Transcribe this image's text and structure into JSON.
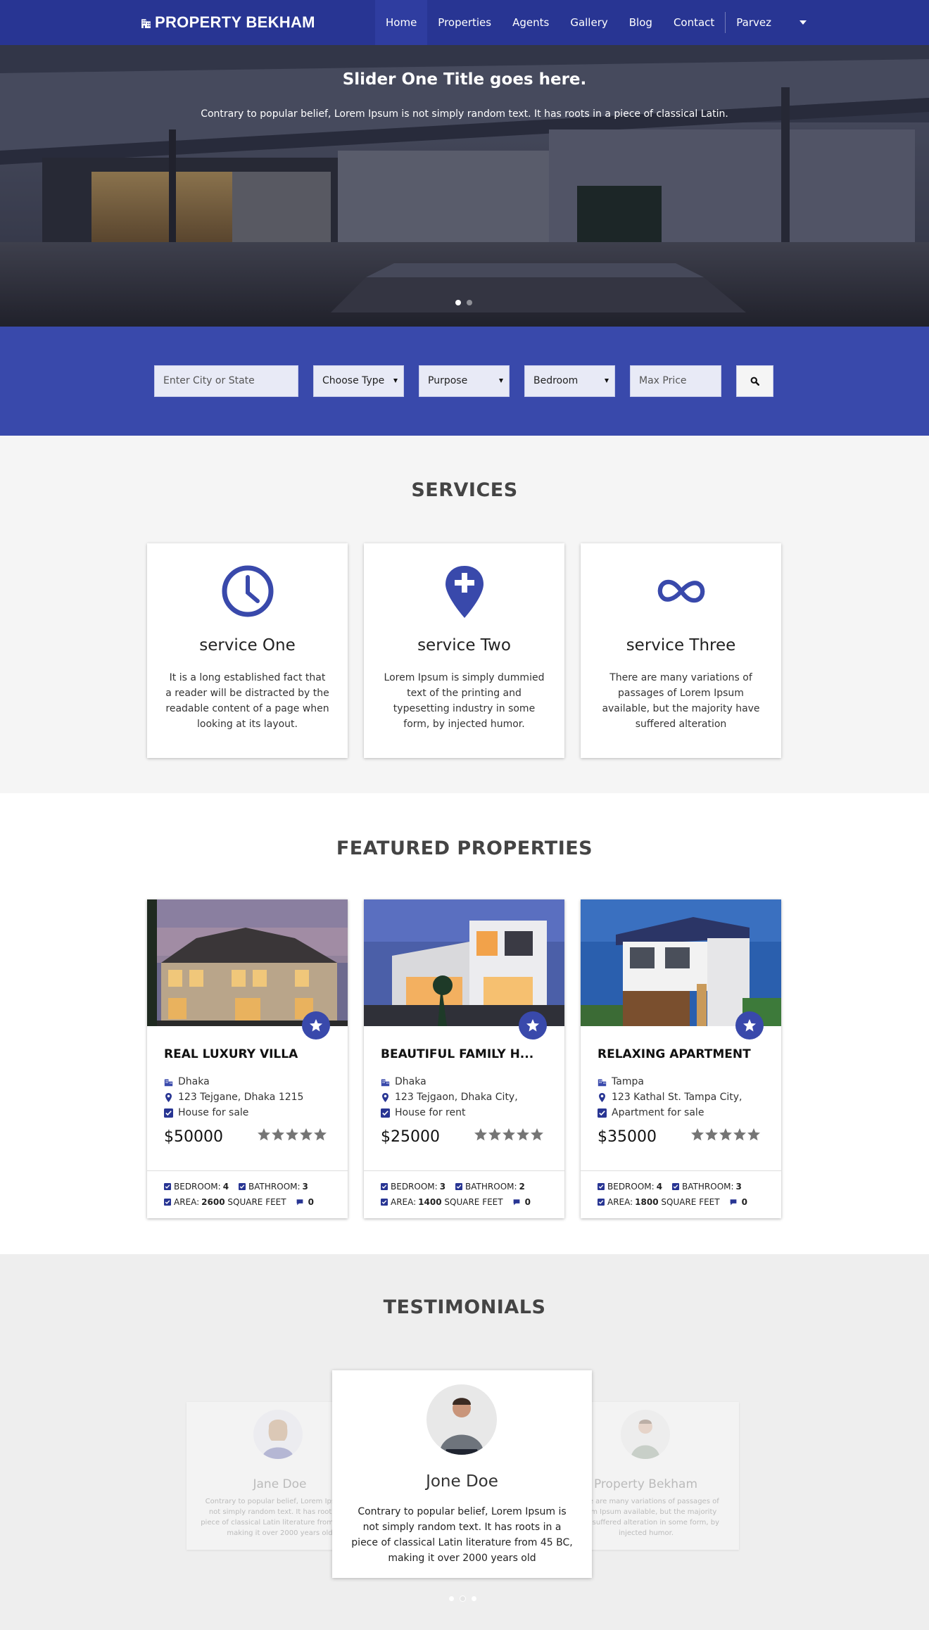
{
  "navbar": {
    "brand": "PROPERTY BEKHAM",
    "items": [
      "Home",
      "Properties",
      "Agents",
      "Gallery",
      "Blog",
      "Contact"
    ],
    "user": "Parvez",
    "active": "Home"
  },
  "hero": {
    "title": "Slider One Title goes here.",
    "subtitle": "Contrary to popular belief, Lorem Ipsum is not simply random text. It has roots in a piece of classical Latin."
  },
  "search": {
    "city_placeholder": "Enter City or State",
    "type_select": "Choose Type",
    "purpose_select": "Purpose",
    "bedroom_select": "Bedroom",
    "price_placeholder": "Max Price"
  },
  "services": {
    "title": "SERVICES",
    "items": [
      {
        "name": "service One",
        "text": "It is a long established fact that a reader will be distracted by the readable content of a page when looking at its layout.",
        "icon": "clock-icon"
      },
      {
        "name": "service Two",
        "text": "Lorem Ipsum is simply dummied text of the printing and typesetting industry in some form, by injected humor.",
        "icon": "map-pin-plus-icon"
      },
      {
        "name": "service Three",
        "text": "There are many variations of passages of Lorem Ipsum available, but the majority have suffered alteration",
        "icon": "infinity-icon"
      }
    ]
  },
  "featured": {
    "title": "FEATURED PROPERTIES",
    "properties": [
      {
        "title": "REAL LUXURY VILLA",
        "city": "Dhaka",
        "address": "123 Tejgane, Dhaka 1215",
        "status": "House for sale",
        "price": "$50000",
        "rating": 5,
        "bedroom_label": "BEDROOM:",
        "bedroom": "4",
        "bathroom_label": "BATHROOM:",
        "bathroom": "3",
        "area_label": "AREA:",
        "area": "2600",
        "area_unit": "SQUARE FEET",
        "comments": "0"
      },
      {
        "title": "BEAUTIFUL FAMILY H...",
        "city": "Dhaka",
        "address": "123 Tejgaon, Dhaka City,",
        "status": "House for rent",
        "price": "$25000",
        "rating": 5,
        "bedroom_label": "BEDROOM:",
        "bedroom": "3",
        "bathroom_label": "BATHROOM:",
        "bathroom": "2",
        "area_label": "AREA:",
        "area": "1400",
        "area_unit": "SQUARE FEET",
        "comments": "0"
      },
      {
        "title": "RELAXING APARTMENT",
        "city": "Tampa",
        "address": "123 Kathal St. Tampa City,",
        "status": "Apartment for sale",
        "price": "$35000",
        "rating": 5,
        "bedroom_label": "BEDROOM:",
        "bedroom": "4",
        "bathroom_label": "BATHROOM:",
        "bathroom": "3",
        "area_label": "AREA:",
        "area": "1800",
        "area_unit": "SQUARE FEET",
        "comments": "0"
      }
    ]
  },
  "testimonials": {
    "title": "TESTIMONIALS",
    "left": {
      "name": "Jane Doe",
      "text": "Contrary to popular belief, Lorem Ipsum is not simply random text. It has roots in a piece of classical Latin literature from 45 BC, making it over 2000 years old"
    },
    "main": {
      "name": "Jone Doe",
      "text": "Contrary to popular belief, Lorem Ipsum is not simply random text. It has roots in a piece of classical Latin literature from 45 BC, making it over 2000 years old"
    },
    "right": {
      "name": "Property Bekham",
      "text": "There are many variations of passages of Lorem Ipsum available, but the majority have suffered alteration in some form, by injected humor."
    }
  },
  "colors": {
    "navbar": "#283593",
    "accent": "#3949ab",
    "services_bg": "#f5f5f5",
    "testimonials_bg": "#eeeeee"
  }
}
